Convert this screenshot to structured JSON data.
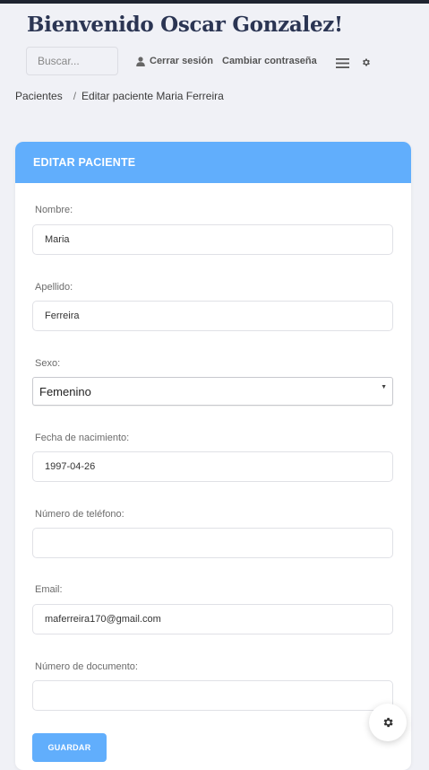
{
  "header": {
    "welcome": "Bienvenido Oscar Gonzalez!",
    "search_placeholder": "Buscar...",
    "logout_label": "Cerrar sesión",
    "change_password_label": "Cambiar contraseña",
    "icons": [
      "user-icon",
      "hamburger-menu-icon",
      "gear-icon"
    ]
  },
  "breadcrumb": {
    "root": "Pacientes",
    "current": "Editar paciente Maria Ferreira"
  },
  "card": {
    "title": "EDITAR PACIENTE",
    "fields": {
      "nombre": {
        "label": "Nombre:",
        "value": "Maria"
      },
      "apellido": {
        "label": "Apellido:",
        "value": "Ferreira"
      },
      "sexo": {
        "label": "Sexo:",
        "value": "Femenino"
      },
      "fecha": {
        "label": "Fecha de nacimiento:",
        "value": "1997-04-26"
      },
      "telefono": {
        "label": "Número de teléfono:",
        "value": ""
      },
      "email": {
        "label": "Email:",
        "value": "maferreira170@gmail.com"
      },
      "documento": {
        "label": "Número de documento:",
        "value": ""
      }
    },
    "save_label": "GUARDAR"
  },
  "fab": {
    "icon": "gear-icon"
  },
  "colors": {
    "accent": "#61aefc",
    "title": "#2b3553",
    "background": "#f0f1f6"
  }
}
